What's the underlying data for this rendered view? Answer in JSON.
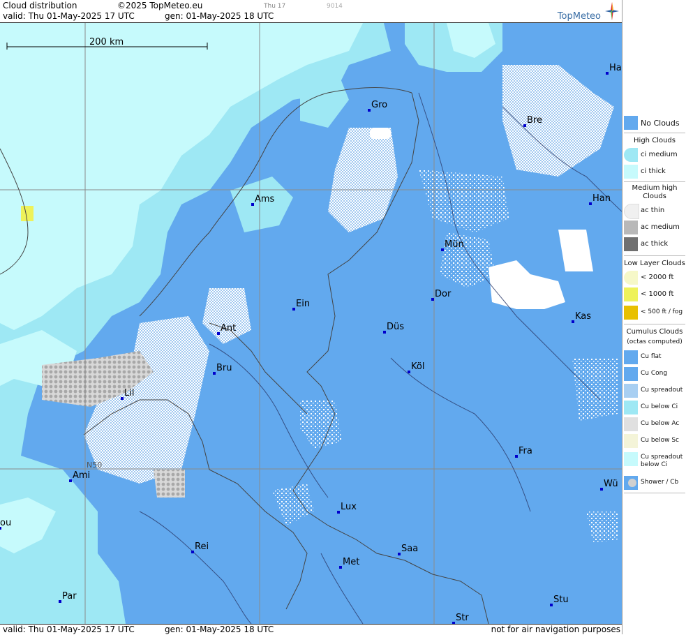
{
  "header": {
    "title": "Cloud distribution",
    "copyright": "©2025 TopMeteo.eu",
    "time_small": "Thu 17",
    "code_small": "9014",
    "valid": "valid:  Thu  01-May-2025  17 UTC",
    "gen": "gen: 01-May-2025 18 UTC",
    "brand": "TopMeteo"
  },
  "footer": {
    "valid": "valid:  Thu  01-May-2025  17 UTC",
    "gen": "gen: 01-May-2025 18 UTC",
    "disclaimer": "not for air navigation purposes"
  },
  "map": {
    "scale_label": "200 km",
    "grid_label": "N50",
    "cities": [
      {
        "name": "Gro"
      },
      {
        "name": "Bre"
      },
      {
        "name": "Ha"
      },
      {
        "name": "Ams"
      },
      {
        "name": "Han"
      },
      {
        "name": "Mün"
      },
      {
        "name": "Dor"
      },
      {
        "name": "Ein"
      },
      {
        "name": "Ant"
      },
      {
        "name": "Düs"
      },
      {
        "name": "Kas"
      },
      {
        "name": "Bru"
      },
      {
        "name": "Köl"
      },
      {
        "name": "Lil"
      },
      {
        "name": "Fra"
      },
      {
        "name": "Ami"
      },
      {
        "name": "Wü"
      },
      {
        "name": "Lux"
      },
      {
        "name": "ou"
      },
      {
        "name": "Rei"
      },
      {
        "name": "Saa"
      },
      {
        "name": "Met"
      },
      {
        "name": "Par"
      },
      {
        "name": "Stu"
      },
      {
        "name": "Str"
      }
    ]
  },
  "legend": {
    "no_clouds": "No Clouds",
    "high_title": "High Clouds",
    "ci_medium": "ci medium",
    "ci_thick": "ci thick",
    "medium_title_1": "Medium high",
    "medium_title_2": "Clouds",
    "ac_thin": "ac thin",
    "ac_medium": "ac medium",
    "ac_thick": "ac thick",
    "low_title": "Low Layer Clouds",
    "low_2000": "< 2000 ft",
    "low_1000": "< 1000 ft",
    "low_500": "< 500 ft / fog",
    "cu_title": "Cumulus Clouds",
    "cu_sub": "(octas computed)",
    "cu_flat": "Cu flat",
    "cu_cong": "Cu Cong",
    "cu_spreadout": "Cu spreadout",
    "cu_below_ci": "Cu below Ci",
    "cu_below_ac": "Cu below Ac",
    "cu_below_sc": "Cu below Sc",
    "cu_spreadout_below_ci_1": "Cu spreadout",
    "cu_spreadout_below_ci_2": "below Ci",
    "shower": "Shower / Cb"
  },
  "colors": {
    "cu_flat": "#62a9ee",
    "ci_medium": "#9ee8f4",
    "ci_thick": "#c6fafc",
    "low_1000": "#eef25a",
    "low_500": "#e8c000",
    "ac_medium": "#b8b8b8",
    "ac_thick": "#707070"
  }
}
